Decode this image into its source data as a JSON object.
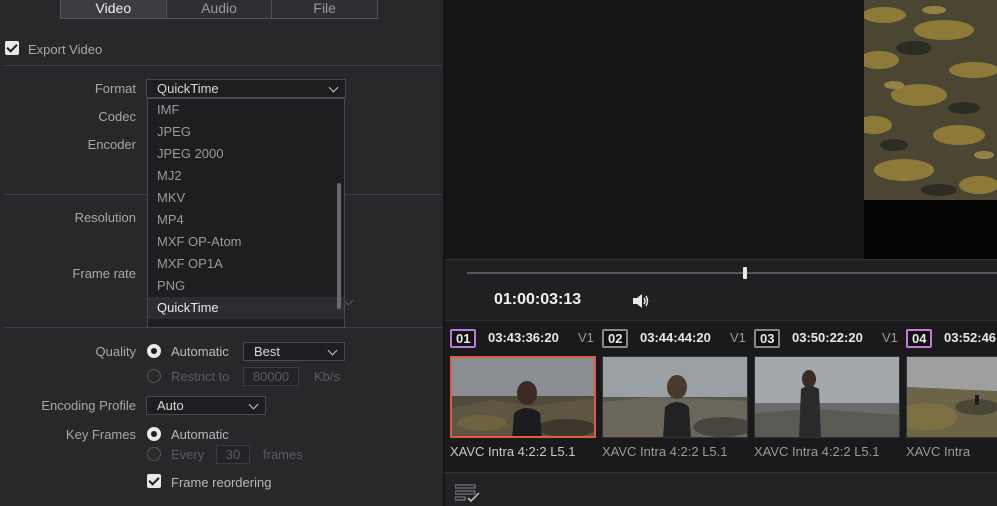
{
  "tabs": [
    "Video",
    "Audio",
    "File"
  ],
  "export_video": {
    "label": "Export Video",
    "checked": true
  },
  "format": {
    "label": "Format",
    "value": "QuickTime"
  },
  "codec": {
    "label": "Codec"
  },
  "encoder": {
    "label": "Encoder"
  },
  "format_menu": {
    "items": [
      "IMF",
      "JPEG",
      "JPEG 2000",
      "MJ2",
      "MKV",
      "MP4",
      "MXF OP-Atom",
      "MXF OP1A",
      "PNG",
      "QuickTime"
    ],
    "selected": "QuickTime"
  },
  "resolution": {
    "label": "Resolution"
  },
  "frame_rate": {
    "label": "Frame rate"
  },
  "quality": {
    "label": "Quality",
    "automatic_label": "Automatic",
    "automatic_value": "Best",
    "restrict_label": "Restrict to",
    "restrict_value": "80000",
    "restrict_unit": "Kb/s"
  },
  "encoding_profile": {
    "label": "Encoding Profile",
    "value": "Auto"
  },
  "key_frames": {
    "label": "Key Frames",
    "automatic_label": "Automatic",
    "every_label": "Every",
    "every_value": "30",
    "every_unit": "frames"
  },
  "frame_reordering": {
    "label": "Frame reordering",
    "checked": true
  },
  "viewer": {
    "timecode": "01:00:03:13",
    "playhead_fraction": 0.52
  },
  "clips": [
    {
      "num": "01",
      "timecode": "03:43:36:20",
      "track": "V1",
      "caption": "XAVC Intra 4:2:2 L5.1",
      "selected": true,
      "color": "#b87bd6"
    },
    {
      "num": "02",
      "timecode": "03:44:44:20",
      "track": "V1",
      "caption": "XAVC Intra 4:2:2 L5.1",
      "selected": false,
      "color": "#9a9a9a"
    },
    {
      "num": "03",
      "timecode": "03:50:22:20",
      "track": "V1",
      "caption": "XAVC Intra 4:2:2 L5.1",
      "selected": false,
      "color": "#9a9a9a"
    },
    {
      "num": "04",
      "timecode": "03:52:46:",
      "track": "",
      "caption": "XAVC Intra",
      "selected": false,
      "color": "#c879d8"
    }
  ],
  "colors": {
    "accent_selection": "#e05a44",
    "panel": "#28282b",
    "background": "#1c1c1e"
  }
}
